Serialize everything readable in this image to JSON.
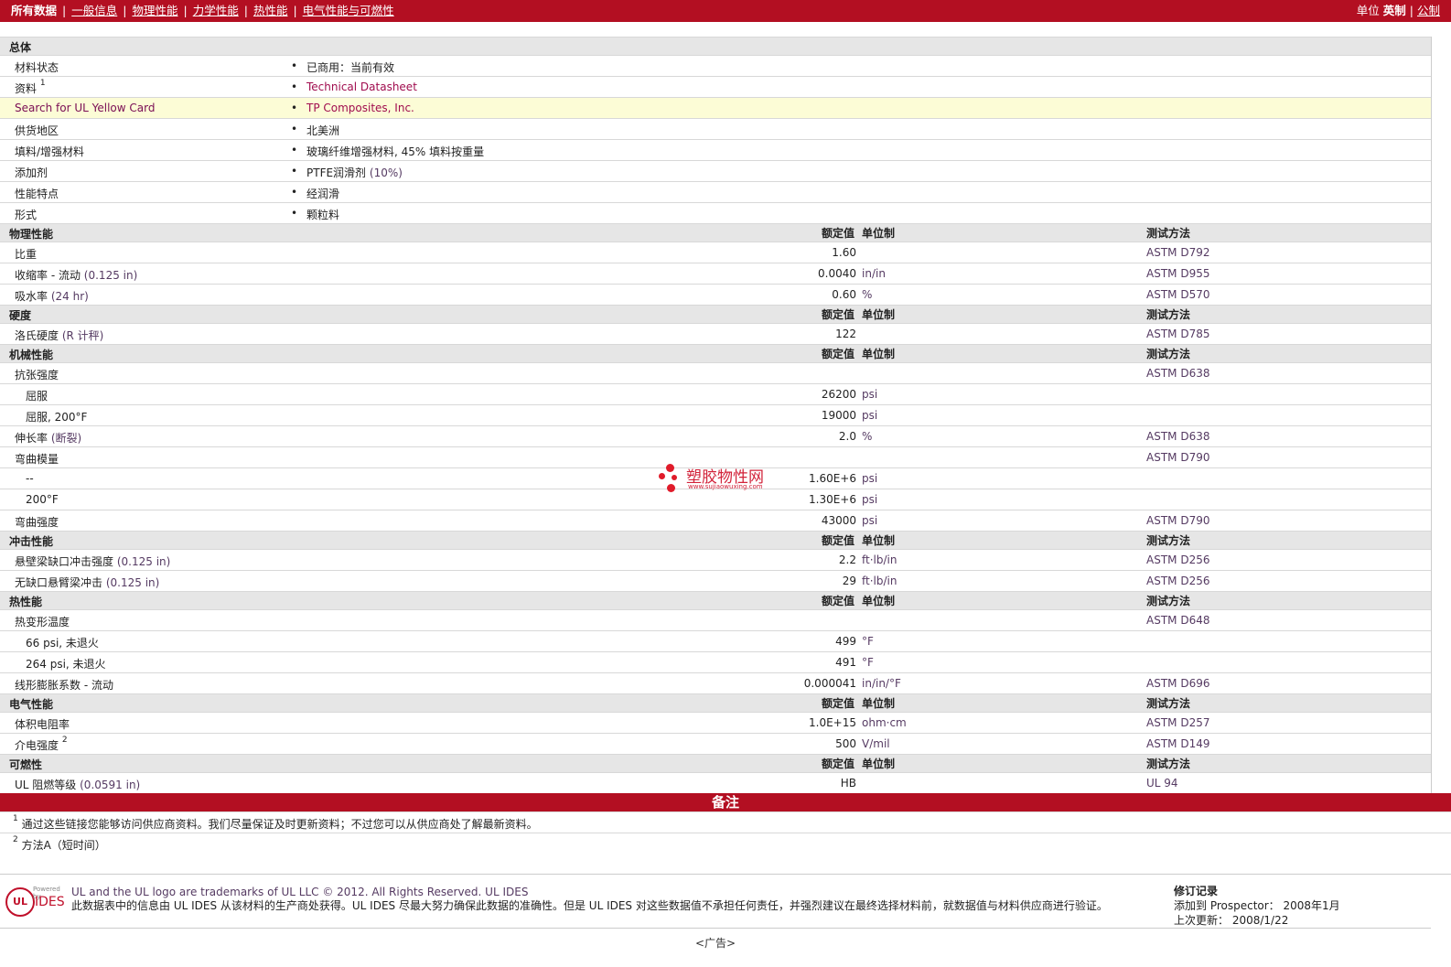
{
  "topbar": {
    "items": [
      "所有数据",
      "一般信息",
      "物理性能",
      "力学性能",
      "热性能",
      "电气性能与可燃性"
    ],
    "units_label": "单位",
    "unit_imperial": "英制",
    "unit_metric": "公制"
  },
  "general": {
    "title": "总体",
    "rows": [
      {
        "label": "材料状态",
        "value": "已商用：当前有效"
      },
      {
        "label": "资料",
        "sup": "1",
        "value": "Technical Datasheet",
        "link": true
      },
      {
        "label": "Search for UL Yellow Card",
        "value": "TP Composites, Inc.",
        "link": true,
        "highlight": true
      },
      {
        "label": "供货地区",
        "value": "北美洲"
      },
      {
        "label": "填料/增强材料",
        "value": "玻璃纤维增强材料, 45% 填料按重量"
      },
      {
        "label": "添加剂",
        "value": "PTFE润滑剂",
        "cond": "(10%)"
      },
      {
        "label": "性能特点",
        "value": "经润滑"
      },
      {
        "label": "形式",
        "value": "颗粒料"
      }
    ]
  },
  "col_headers": {
    "value": "额定值",
    "unit": "单位制",
    "method": "测试方法"
  },
  "sections": [
    {
      "title": "物理性能",
      "rows": [
        {
          "label": "比重",
          "value": "1.60",
          "unit": "",
          "method": "ASTM D792"
        },
        {
          "label": "收缩率 - 流动",
          "cond": "(0.125 in)",
          "value": "0.0040",
          "unit": "in/in",
          "method": "ASTM D955"
        },
        {
          "label": "吸水率",
          "cond": "(24 hr)",
          "value": "0.60",
          "unit": "%",
          "method": "ASTM D570"
        }
      ]
    },
    {
      "title": "硬度",
      "rows": [
        {
          "label": "洛氏硬度",
          "cond": "(R 计秤)",
          "value": "122",
          "unit": "",
          "method": "ASTM D785"
        }
      ]
    },
    {
      "title": "机械性能",
      "rows": [
        {
          "label": "抗张强度",
          "value": "",
          "unit": "",
          "method": "ASTM D638"
        },
        {
          "label": "屈服",
          "indent": true,
          "value": "26200",
          "unit": "psi",
          "method": ""
        },
        {
          "label": "屈服, 200°F",
          "indent": true,
          "value": "19000",
          "unit": "psi",
          "method": ""
        },
        {
          "label": "伸长率",
          "cond": "(断裂)",
          "value": "2.0",
          "unit": "%",
          "method": "ASTM D638"
        },
        {
          "label": "弯曲模量",
          "value": "",
          "unit": "",
          "method": "ASTM D790"
        },
        {
          "label": "--",
          "indent": true,
          "value": "1.60E+6",
          "unit": "psi",
          "method": ""
        },
        {
          "label": "200°F",
          "indent": true,
          "value": "1.30E+6",
          "unit": "psi",
          "method": ""
        },
        {
          "label": "弯曲强度",
          "value": "43000",
          "unit": "psi",
          "method": "ASTM D790"
        }
      ]
    },
    {
      "title": "冲击性能",
      "rows": [
        {
          "label": "悬壁梁缺口冲击强度",
          "cond": "(0.125 in)",
          "value": "2.2",
          "unit": "ft·lb/in",
          "method": "ASTM D256"
        },
        {
          "label": "无缺口悬臂梁冲击",
          "cond": "(0.125 in)",
          "value": "29",
          "unit": "ft·lb/in",
          "method": "ASTM D256"
        }
      ]
    },
    {
      "title": "热性能",
      "rows": [
        {
          "label": "热变形温度",
          "value": "",
          "unit": "",
          "method": "ASTM D648"
        },
        {
          "label": "66 psi, 未退火",
          "indent": true,
          "value": "499",
          "unit": "°F",
          "method": ""
        },
        {
          "label": "264 psi, 未退火",
          "indent": true,
          "value": "491",
          "unit": "°F",
          "method": ""
        },
        {
          "label": "线形膨胀系数 - 流动",
          "value": "0.000041",
          "unit": "in/in/°F",
          "method": "ASTM D696"
        }
      ]
    },
    {
      "title": "电气性能",
      "rows": [
        {
          "label": "体积电阻率",
          "value": "1.0E+15",
          "unit": "ohm·cm",
          "method": "ASTM D257"
        },
        {
          "label": "介电强度",
          "sup": "2",
          "value": "500",
          "unit": "V/mil",
          "method": "ASTM D149"
        }
      ]
    },
    {
      "title": "可燃性",
      "rows": [
        {
          "label": "UL 阻燃等级",
          "cond": "(0.0591 in)",
          "value": "HB",
          "unit": "",
          "method": "UL 94"
        }
      ]
    }
  ],
  "notes": {
    "title": "备注",
    "items": [
      {
        "sup": "1",
        "text": "通过这些链接您能够访问供应商资料。我们尽量保证及时更新资料；不过您可以从供应商处了解最新资料。"
      },
      {
        "sup": "2",
        "text": "方法A（短时间）"
      }
    ]
  },
  "watermark": {
    "title": "塑胶物性网",
    "url": "www.sujiaowuxing.com"
  },
  "footer": {
    "logo_powered": "Powered by",
    "logo_ul": "UL",
    "logo_ides": "IDES",
    "line1": "UL and the UL logo are trademarks of UL LLC © 2012. All Rights Reserved. UL IDES",
    "line2": "此数据表中的信息由 UL IDES 从该材料的生产商处获得。UL IDES 尽最大努力确保此数据的准确性。但是 UL IDES 对这些数据值不承担任何责任，并强烈建议在最终选择材料前，就数据值与材料供应商进行验证。",
    "rev_title": "修订记录",
    "rev_added": "添加到 Prospector： 2008年1月",
    "rev_updated": "上次更新： 2008/1/22",
    "ad": "<广告>"
  }
}
